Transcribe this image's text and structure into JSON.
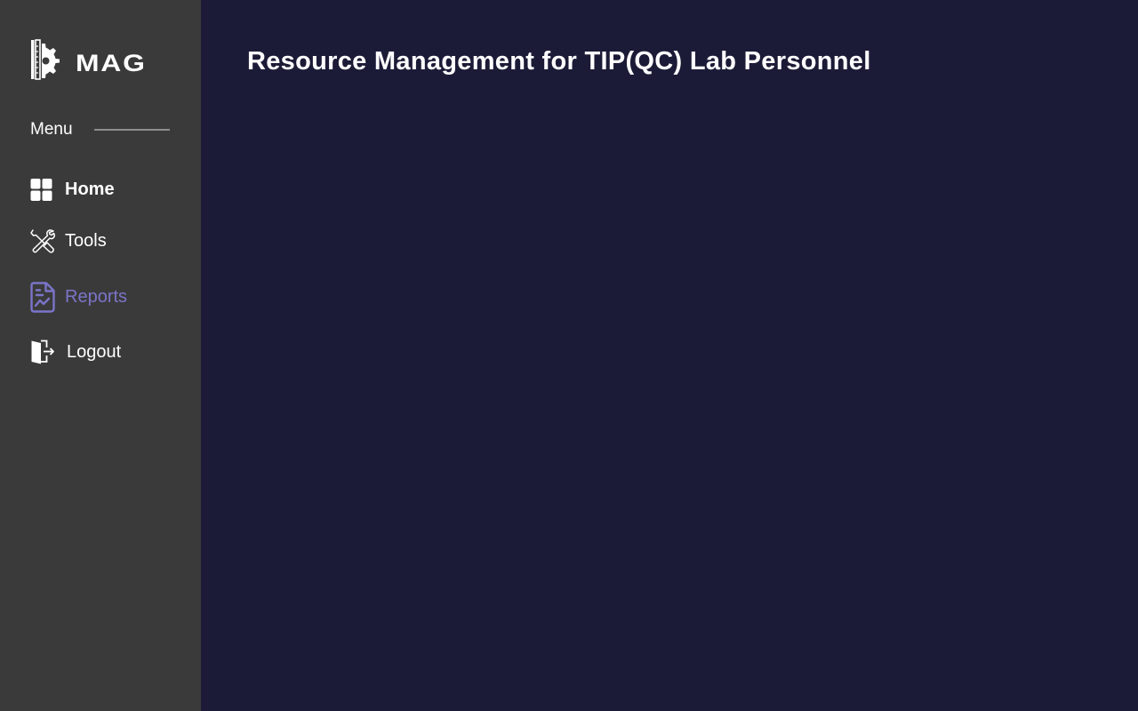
{
  "brand": {
    "name": "MAG",
    "logo_icon": "ruler-gear-icon"
  },
  "sidebar": {
    "menu_heading": "Menu",
    "items": [
      {
        "label": "Home",
        "icon": "dashboard-grid-icon",
        "active": false
      },
      {
        "label": "Tools",
        "icon": "wrench-screwdriver-icon",
        "active": false
      },
      {
        "label": "Reports",
        "icon": "report-document-icon",
        "active": true
      },
      {
        "label": "Logout",
        "icon": "door-exit-icon",
        "active": false
      }
    ]
  },
  "main": {
    "title": "Resource Management for TIP(QC) Lab Personnel"
  },
  "colors": {
    "sidebar_bg": "#3a3a3a",
    "main_bg": "#1c1b37",
    "active_accent": "#7b74c9",
    "text": "#ffffff"
  }
}
